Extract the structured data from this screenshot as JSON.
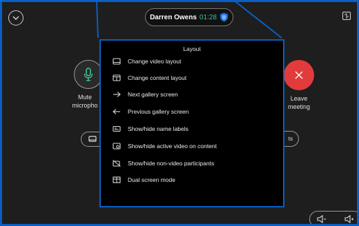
{
  "header": {
    "participant_name": "Darren Owens",
    "call_time": "01:28"
  },
  "controls": {
    "mute_label": "Mute microphone",
    "mute_label_visible": "Mute\nmicropho",
    "leave_label": "Leave meeting",
    "right_pill_text": "ts"
  },
  "menu": {
    "title": "Layout",
    "items": [
      {
        "label": "Change video layout",
        "icon": "monitor-icon"
      },
      {
        "label": "Change content layout",
        "icon": "content-layout-icon"
      },
      {
        "label": "Next gallery screen",
        "icon": "arrow-right-icon"
      },
      {
        "label": "Previous gallery screen",
        "icon": "arrow-left-icon"
      },
      {
        "label": "Show/hide name labels",
        "icon": "name-label-icon"
      },
      {
        "label": "Show/hide active video on content",
        "icon": "active-video-icon"
      },
      {
        "label": "Show/hide non-video participants",
        "icon": "non-video-icon"
      },
      {
        "label": "Dual screen mode",
        "icon": "dual-screen-icon"
      }
    ]
  },
  "colors": {
    "accent_border": "#0a5fc5",
    "timer_green": "#3cc29a",
    "leave_red": "#e23b3b",
    "mic_green": "#3cc29a"
  }
}
